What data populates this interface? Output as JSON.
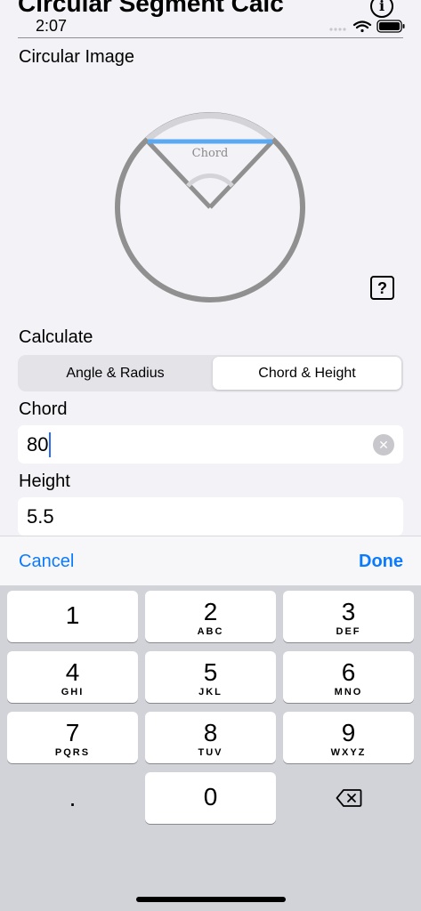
{
  "nav": {
    "title": "Circular Segment Calc",
    "info_icon": "info-icon"
  },
  "status_bar": {
    "time": "2:07"
  },
  "image_section": {
    "label": "Circular Image",
    "chord_label": "Chord",
    "help_label": "?"
  },
  "calculate": {
    "label": "Calculate",
    "segments": [
      {
        "label": "Angle & Radius"
      },
      {
        "label": "Chord & Height"
      }
    ],
    "selected": "Chord & Height"
  },
  "fields": {
    "chord": {
      "label": "Chord",
      "value": "80"
    },
    "height": {
      "label": "Height",
      "value": "5.5"
    }
  },
  "accessory": {
    "cancel": "Cancel",
    "done": "Done"
  },
  "keypad": {
    "keys": [
      {
        "digit": "1",
        "letters": ""
      },
      {
        "digit": "2",
        "letters": "ABC"
      },
      {
        "digit": "3",
        "letters": "DEF"
      },
      {
        "digit": "4",
        "letters": "GHI"
      },
      {
        "digit": "5",
        "letters": "JKL"
      },
      {
        "digit": "6",
        "letters": "MNO"
      },
      {
        "digit": "7",
        "letters": "PQRS"
      },
      {
        "digit": "8",
        "letters": "TUV"
      },
      {
        "digit": "9",
        "letters": "WXYZ"
      }
    ],
    "decimal": ".",
    "zero": "0",
    "delete_icon": "backspace-icon"
  },
  "colors": {
    "accent": "#0a7aff",
    "chord": "#5aa9f2",
    "arc": "#909090"
  }
}
